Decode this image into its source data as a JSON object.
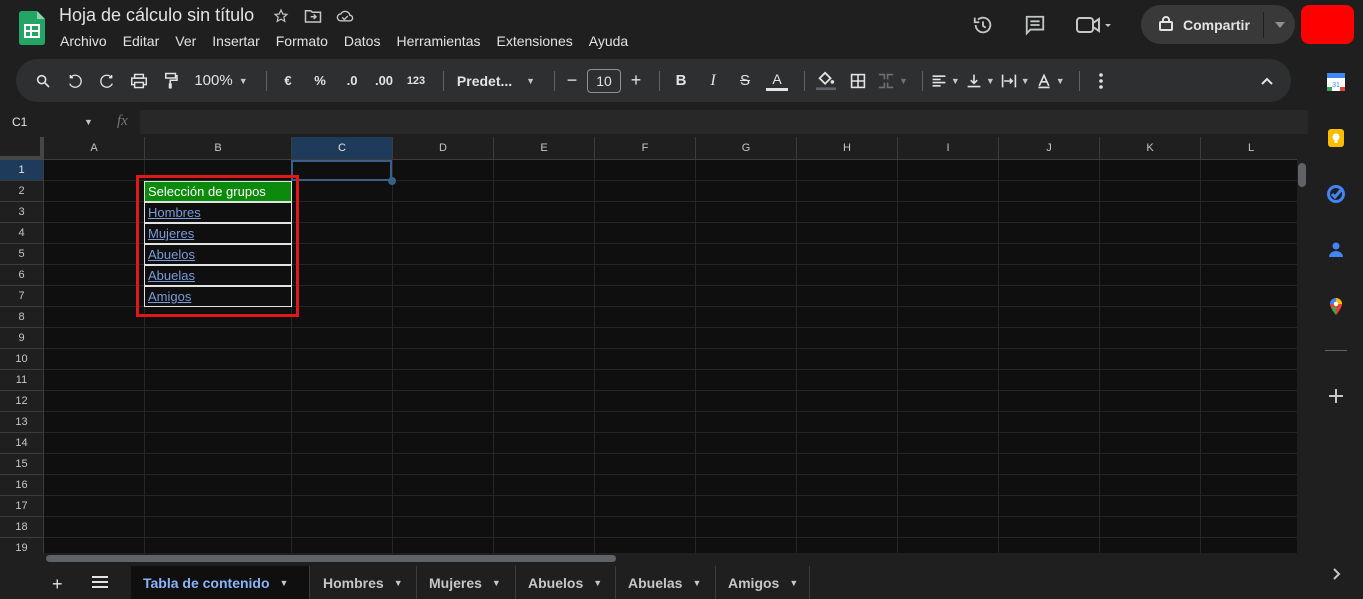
{
  "doc": {
    "title": "Hoja de cálculo sin título"
  },
  "menu": [
    "Archivo",
    "Editar",
    "Ver",
    "Insertar",
    "Formato",
    "Datos",
    "Herramientas",
    "Extensiones",
    "Ayuda"
  ],
  "share": {
    "label": "Compartir"
  },
  "toolbar": {
    "zoom": "100%",
    "currency": "€",
    "percent": "%",
    "decrease_decimals": ".0",
    "increase_decimals": ".00",
    "number_format": "123",
    "font": "Predet...",
    "font_size": "10"
  },
  "formula": {
    "cell_ref": "C1",
    "fx": "fx"
  },
  "columns": [
    "A",
    "B",
    "C",
    "D",
    "E",
    "F",
    "G",
    "H",
    "I",
    "J",
    "K",
    "L"
  ],
  "rows": [
    "1",
    "2",
    "3",
    "4",
    "5",
    "6",
    "7",
    "8",
    "9",
    "10",
    "11",
    "12",
    "13",
    "14",
    "15",
    "16",
    "17",
    "18",
    "19"
  ],
  "selected_column": "C",
  "selected_row": "1",
  "table": {
    "header": "Selección de grupos",
    "links": [
      "Hombres",
      "Mujeres",
      "Abuelos",
      "Abuelas",
      "Amigos"
    ]
  },
  "tabs": [
    {
      "label": "Tabla de contenido",
      "active": true
    },
    {
      "label": "Hombres",
      "active": false
    },
    {
      "label": "Mujeres",
      "active": false
    },
    {
      "label": "Abuelos",
      "active": false
    },
    {
      "label": "Abuelas",
      "active": false
    },
    {
      "label": "Amigos",
      "active": false
    }
  ],
  "colors": {
    "header_fill": "#0b8a0b",
    "link": "#7b9cd8",
    "highlight_frame": "#e01818",
    "avatar": "#ff0000",
    "active_tab": "#8ab4f8"
  }
}
